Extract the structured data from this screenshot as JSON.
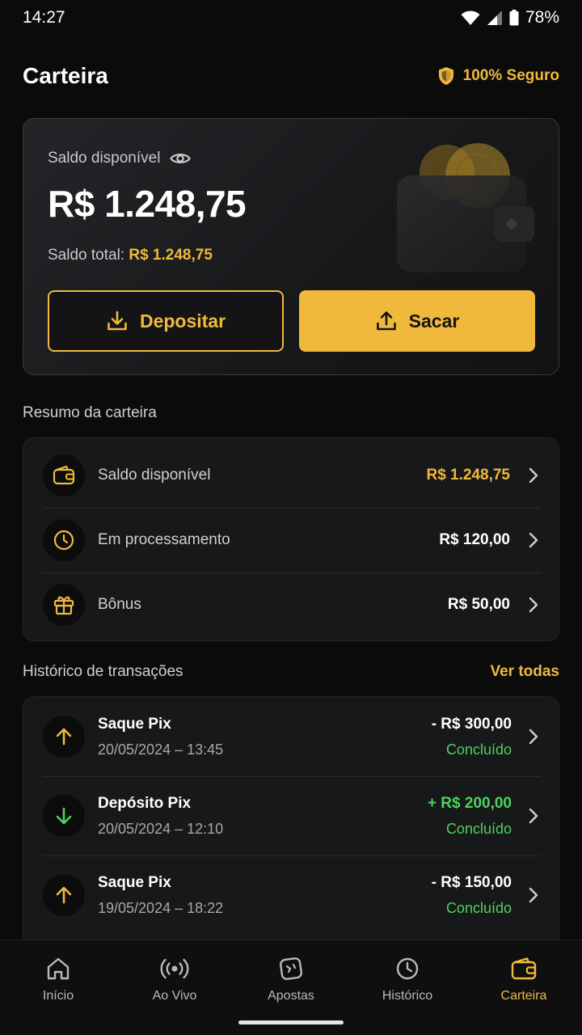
{
  "status_bar": {
    "time": "14:27",
    "battery": "78%"
  },
  "header": {
    "title": "Carteira",
    "secure_label": "100% Seguro"
  },
  "balance": {
    "label": "Saldo disponível",
    "value": "R$ 1.248,75",
    "total_label": "Saldo total:",
    "total_value": "R$ 1.248,75",
    "deposit_label": "Depositar",
    "withdraw_label": "Sacar"
  },
  "summary": {
    "title": "Resumo da carteira",
    "rows": [
      {
        "icon": "wallet-icon",
        "label": "Saldo disponível",
        "value": "R$ 1.248,75"
      },
      {
        "icon": "clock-icon",
        "label": "Em processamento",
        "value": "R$ 120,00"
      },
      {
        "icon": "gift-icon",
        "label": "Bônus",
        "value": "R$ 50,00"
      }
    ]
  },
  "transactions": {
    "title": "Histórico de transações",
    "see_all": "Ver todas",
    "items": [
      {
        "type": "withdraw",
        "icon": "arrow-up-icon",
        "title": "Saque Pix",
        "date": "20/05/2024 – 13:45",
        "amount": "- R$ 300,00",
        "status": "Concluído"
      },
      {
        "type": "deposit",
        "icon": "arrow-down-icon",
        "title": "Depósito Pix",
        "date": "20/05/2024 – 12:10",
        "amount": "+ R$ 200,00",
        "status": "Concluído"
      },
      {
        "type": "withdraw",
        "icon": "arrow-up-icon",
        "title": "Saque Pix",
        "date": "19/05/2024 – 18:22",
        "amount": "- R$ 150,00",
        "status": "Concluído"
      }
    ]
  },
  "nav": {
    "items": [
      {
        "icon": "home-icon",
        "label": "Início"
      },
      {
        "icon": "live-icon",
        "label": "Ao Vivo"
      },
      {
        "icon": "ticket-icon",
        "label": "Apostas"
      },
      {
        "icon": "history-icon",
        "label": "Histórico"
      },
      {
        "icon": "wallet-icon",
        "label": "Carteira"
      }
    ],
    "active_index": 4
  },
  "colors": {
    "accent": "#f0b93c",
    "positive": "#4cd35e",
    "background": "#0b0b0c",
    "card": "#17181a"
  }
}
